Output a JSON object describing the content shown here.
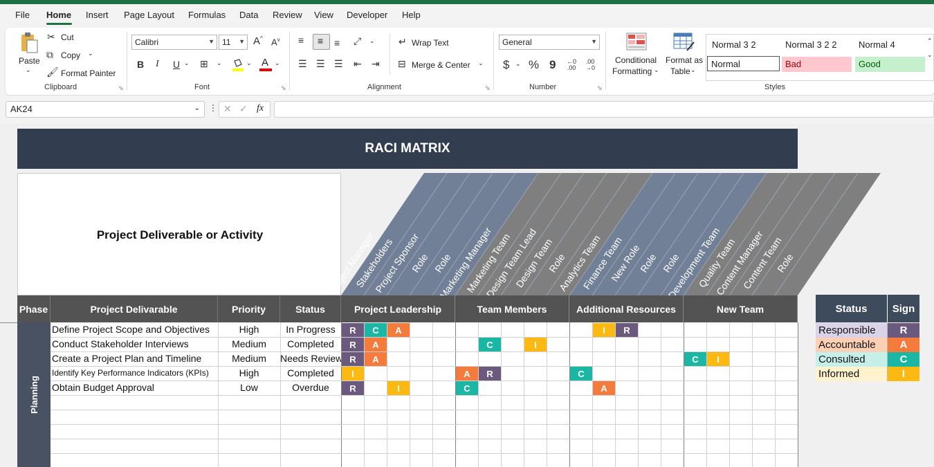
{
  "menu": {
    "items": [
      "File",
      "Home",
      "Insert",
      "Page Layout",
      "Formulas",
      "Data",
      "Review",
      "View",
      "Developer",
      "Help"
    ],
    "active": "Home"
  },
  "ribbon": {
    "clipboard": {
      "paste": "Paste",
      "cut": "Cut",
      "copy": "Copy",
      "format_painter": "Format Painter",
      "label": "Clipboard"
    },
    "font": {
      "name": "Calibri",
      "size": "11",
      "label": "Font",
      "increase": "A",
      "decrease": "A",
      "bold": "B",
      "italic": "I",
      "underline": "U",
      "font_color": "A"
    },
    "alignment": {
      "wrap_text": "Wrap Text",
      "merge_center": "Merge & Center",
      "label": "Alignment"
    },
    "number": {
      "format": "General",
      "currency": "$",
      "percent": "%",
      "comma": "9",
      "label": "Number"
    },
    "styles": {
      "conditional_formatting_line1": "Conditional",
      "conditional_formatting_line2": "Formatting",
      "format_as_table_line1": "Format as",
      "format_as_table_line2": "Table",
      "cells": [
        {
          "label": "Normal 3 2"
        },
        {
          "label": "Normal 3 2 2"
        },
        {
          "label": "Normal 4"
        },
        {
          "label": "Normal"
        },
        {
          "label": "Bad"
        },
        {
          "label": "Good"
        }
      ],
      "label": "Styles"
    }
  },
  "formula_bar": {
    "name_box": "AK24",
    "fx": "fx",
    "value": ""
  },
  "sheet": {
    "title": "RACI MATRIX",
    "activity_header": "Project Deliverable or Activity",
    "roles": [
      "Project Manager",
      "Stakeholders",
      "Project Sponsor",
      "Role",
      "Role",
      "Marketing Manager",
      "Marketing Team",
      "Design Team Lead",
      "Design Team",
      "Role",
      "Analytics Team",
      "Finance Team",
      "New Role",
      "Role",
      "Role",
      "Development Team",
      "Quality Team",
      "Content Manager",
      "Content Team",
      "Role"
    ],
    "columns": {
      "phase": "Phase",
      "deliverable": "Project Delivarable",
      "priority": "Priority",
      "status": "Status"
    },
    "groups": [
      "Project Leadership",
      "Team Members",
      "Additional Resources",
      "New Team"
    ],
    "phase_name": "Planning",
    "rows": [
      {
        "deliverable": "Define Project Scope and Objectives",
        "priority": "High",
        "status": "In Progress",
        "raci": [
          "R",
          "C",
          "A",
          "",
          "",
          "",
          "",
          "",
          "",
          "",
          "",
          "I",
          "R",
          "",
          "",
          "",
          "",
          "",
          "",
          ""
        ]
      },
      {
        "deliverable": "Conduct Stakeholder Interviews",
        "priority": "Medium",
        "status": "Completed",
        "raci": [
          "R",
          "A",
          "",
          "",
          "",
          "",
          "C",
          "",
          "I",
          "",
          "",
          "",
          "",
          "",
          "",
          "",
          "",
          "",
          "",
          ""
        ]
      },
      {
        "deliverable": "Create a Project Plan and Timeline",
        "priority": "Medium",
        "status": "Needs Review",
        "raci": [
          "R",
          "A",
          "",
          "",
          "",
          "",
          "",
          "",
          "",
          "",
          "",
          "",
          "",
          "",
          "",
          "C",
          "I",
          "",
          "",
          ""
        ]
      },
      {
        "deliverable": "Identify Key Performance Indicators (KPIs)",
        "priority": "High",
        "status": "Completed",
        "raci": [
          "I",
          "",
          "",
          "",
          "",
          "A",
          "R",
          "",
          "",
          "",
          "C",
          "",
          "",
          "",
          "",
          "",
          "",
          "",
          "",
          ""
        ]
      },
      {
        "deliverable": "Obtain Budget Approval",
        "priority": "Low",
        "status": "Overdue",
        "raci": [
          "R",
          "",
          "I",
          "",
          "",
          "C",
          "",
          "",
          "",
          "",
          "",
          "A",
          "",
          "",
          "",
          "",
          "",
          "",
          "",
          ""
        ]
      }
    ],
    "empty_rows": 5
  },
  "legend": {
    "header_status": "Status",
    "header_sign": "Sign",
    "items": [
      {
        "status": "Responsible",
        "sign": "R",
        "bg": "#d9d2e9",
        "sign_color": "#6b5a7e"
      },
      {
        "status": "Accountable",
        "sign": "A",
        "bg": "#fbd0b5",
        "sign_color": "#f47b3c"
      },
      {
        "status": "Consulted",
        "sign": "C",
        "bg": "#c6efea",
        "sign_color": "#1bb6a4"
      },
      {
        "status": "Informed",
        "sign": "I",
        "bg": "#fff2cc",
        "sign_color": "#fbb912"
      }
    ]
  },
  "colors": {
    "header_dark": "#323e4f",
    "band_blue": "#718096",
    "band_grey": "#7f7f7f",
    "excel_green": "#1e7145"
  }
}
